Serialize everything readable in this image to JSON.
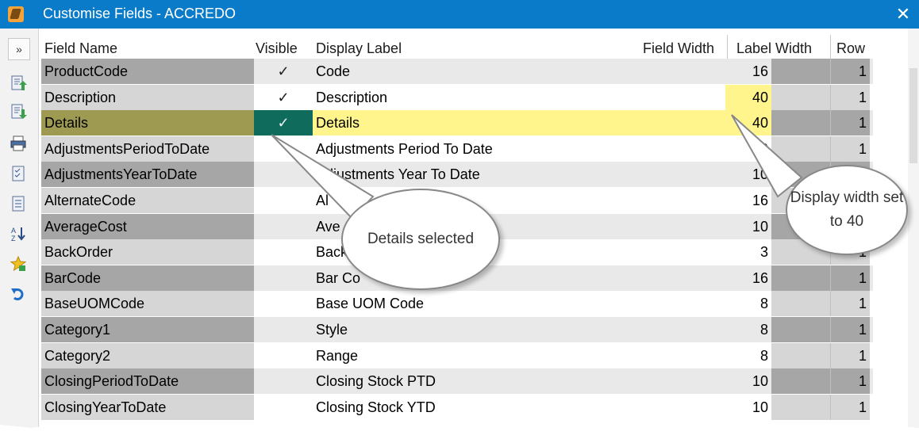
{
  "window": {
    "title": "Customise Fields - ACCREDO",
    "close": "✕"
  },
  "toolbar": {
    "expand": "»"
  },
  "headers": {
    "field_name": "Field Name",
    "visible": "Visible",
    "display_label": "Display Label",
    "field_width": "Field Width",
    "label_width": "Label Width",
    "row": "Row"
  },
  "rows": [
    {
      "field": "ProductCode",
      "visible": "✓",
      "label": "Code",
      "fw": "16",
      "row": "1"
    },
    {
      "field": "Description",
      "visible": "✓",
      "label": "Description",
      "fw": "40",
      "row": "1"
    },
    {
      "field": "Details",
      "visible": "✓",
      "label": "Details",
      "fw": "40",
      "row": "1"
    },
    {
      "field": "AdjustmentsPeriodToDate",
      "visible": "",
      "label": "Adjustments Period To Date",
      "fw": "10",
      "row": "1"
    },
    {
      "field": "AdjustmentsYearToDate",
      "visible": "",
      "label": "Adjustments Year To Date",
      "fw": "10",
      "row": ""
    },
    {
      "field": "AlternateCode",
      "visible": "",
      "label": "Al",
      "fw": "16",
      "row": ""
    },
    {
      "field": "AverageCost",
      "visible": "",
      "label": "Ave",
      "fw": "10",
      "row": ""
    },
    {
      "field": "BackOrder",
      "visible": "",
      "label": "Back",
      "fw": "3",
      "row": "1"
    },
    {
      "field": "BarCode",
      "visible": "",
      "label": "Bar Co",
      "fw": "16",
      "row": "1"
    },
    {
      "field": "BaseUOMCode",
      "visible": "",
      "label": "Base UOM Code",
      "fw": "8",
      "row": "1"
    },
    {
      "field": "Category1",
      "visible": "",
      "label": "Style",
      "fw": "8",
      "row": "1"
    },
    {
      "field": "Category2",
      "visible": "",
      "label": "Range",
      "fw": "8",
      "row": "1"
    },
    {
      "field": "ClosingPeriodToDate",
      "visible": "",
      "label": "Closing Stock PTD",
      "fw": "10",
      "row": "1"
    },
    {
      "field": "ClosingYearToDate",
      "visible": "",
      "label": "Closing Stock YTD",
      "fw": "10",
      "row": "1"
    }
  ],
  "callouts": {
    "details_selected": "Details selected",
    "display_width": "Display width set to 40"
  },
  "colors": {
    "titlebar": "#0a7bc8",
    "selected_field": "#9e9a52",
    "selected_visible": "#0f6b5c",
    "highlight_yellow": "#fff58c",
    "dark_cell": "#a6a6a6",
    "light_cell": "#d6d6d6",
    "band": "#e9e9e9"
  }
}
